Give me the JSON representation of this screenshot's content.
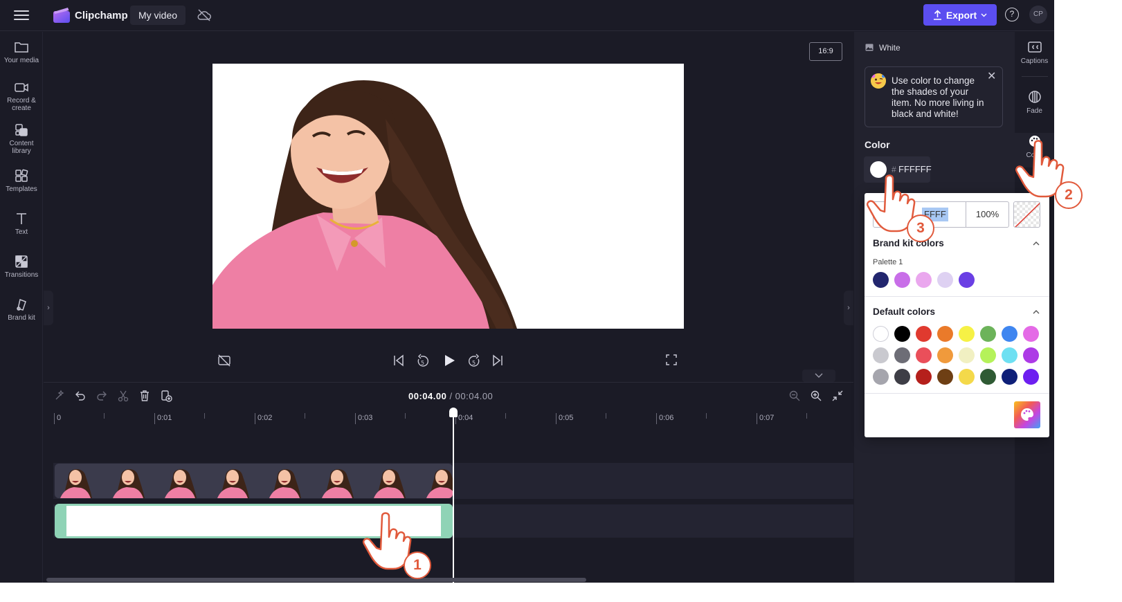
{
  "topbar": {
    "app_name": "Clipchamp",
    "project_title": "My video",
    "export_label": "Export",
    "help_label": "?",
    "avatar_initials": "CP",
    "accent_color": "#5b4ef0"
  },
  "left_rail": {
    "items": [
      {
        "label": "Your media",
        "icon": "folder-icon"
      },
      {
        "label": "Record &\ncreate",
        "icon": "camera-icon"
      },
      {
        "label": "Content\nlibrary",
        "icon": "library-icon"
      },
      {
        "label": "Templates",
        "icon": "templates-icon"
      },
      {
        "label": "Text",
        "icon": "text-icon"
      },
      {
        "label": "Transitions",
        "icon": "transitions-icon"
      },
      {
        "label": "Brand kit",
        "icon": "brand-kit-icon"
      }
    ]
  },
  "preview": {
    "aspect_ratio": "16:9"
  },
  "timeline": {
    "current_time": "00:04.00",
    "separator": " / ",
    "total_time": "00:04.00",
    "ruler_labels": [
      "0",
      "0:01",
      "0:02",
      "0:03",
      "0:04",
      "0:05",
      "0:06",
      "0:07"
    ]
  },
  "properties": {
    "item_name": "White",
    "tip_text": "Use color to change the shades of your item. No more living in black and white!",
    "color_label": "Color",
    "hex_prefix": "#",
    "hex_value": "FFFFFF"
  },
  "right_rail": {
    "items": [
      {
        "label": "Captions",
        "icon": "captions-icon"
      },
      {
        "label": "Fade",
        "icon": "fade-icon"
      },
      {
        "label": "Color",
        "icon": "palette-icon"
      }
    ]
  },
  "color_picker": {
    "hex_input_visible": "FFFF",
    "opacity": "100%",
    "brand_kit_heading": "Brand kit colors",
    "palette_label": "Palette 1",
    "brand_colors": [
      "#22266e",
      "#c86ee8",
      "#eaa7ee",
      "#ded1f2",
      "#6a3fe4"
    ],
    "default_heading": "Default colors",
    "default_colors": [
      [
        "#ffffff",
        "#000000",
        "#e03a2f",
        "#ea7a2a",
        "#f6f145",
        "#6cb35a",
        "#3f86f0",
        "#e46ae6"
      ],
      [
        "#c9c9cf",
        "#6d6d76",
        "#ea4f5a",
        "#f09a3c",
        "#f1f0c2",
        "#b5f25a",
        "#6ee0f2",
        "#ad3ae6"
      ],
      [
        "#a5a5ad",
        "#3e3e46",
        "#b5201c",
        "#6e3f14",
        "#f4d94a",
        "#2f5a34",
        "#0e1f78",
        "#6d1ff0"
      ]
    ]
  },
  "tutorial_steps": [
    "1",
    "2",
    "3"
  ]
}
